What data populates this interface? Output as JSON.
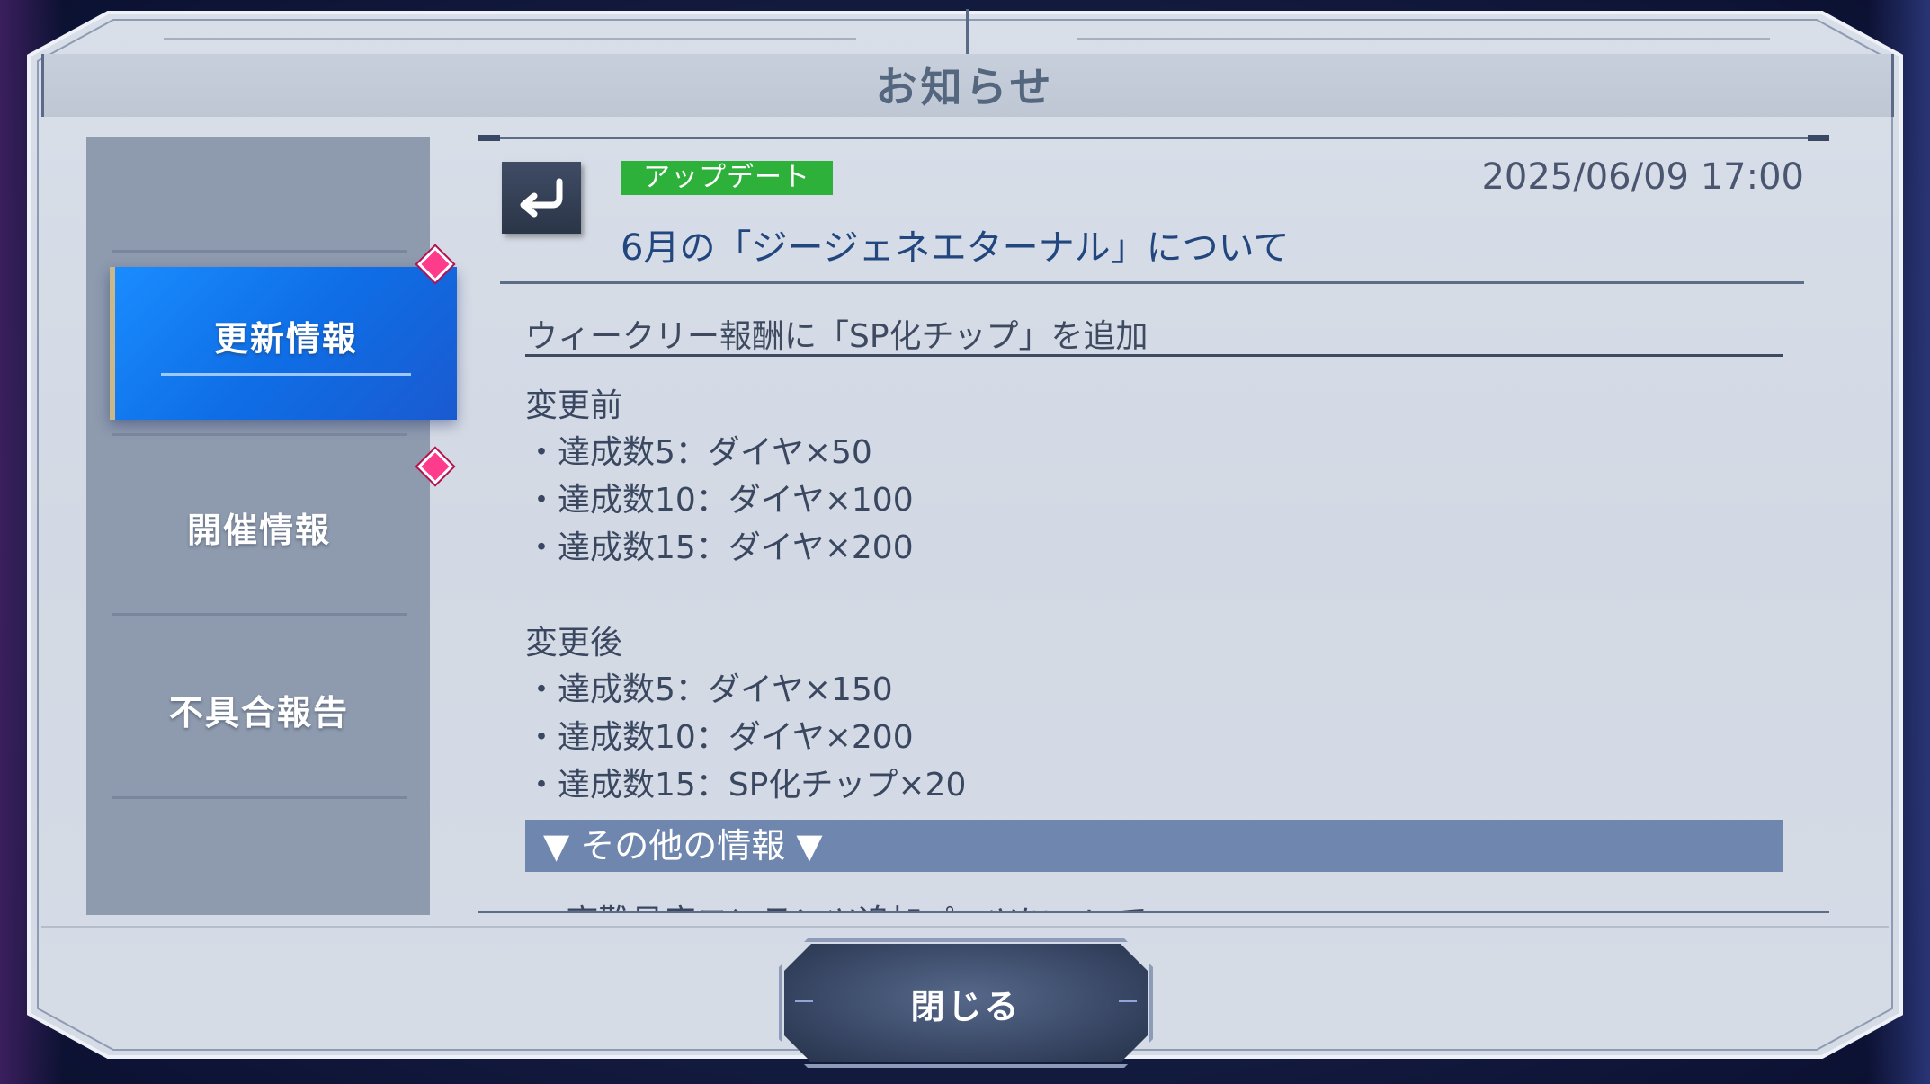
{
  "window": {
    "title": "お知らせ"
  },
  "sidebar": {
    "items": [
      {
        "label": "更新情報",
        "active": true,
        "has_notice": true
      },
      {
        "label": "開催情報",
        "active": false,
        "has_notice": true
      },
      {
        "label": "不具合報告",
        "active": false,
        "has_notice": false
      }
    ]
  },
  "article": {
    "back_icon": "return-arrow-icon",
    "tag": "アップデート",
    "tag_color": "#2db13a",
    "date": "2025/06/09 17:00",
    "headline": "6月の「ジージェネエターナル」について",
    "subhead": "ウィークリー報酬に「SP化チップ」を追加",
    "before_label": "変更前",
    "before_items": [
      "・達成数5：ダイヤ×50",
      "・達成数10：ダイヤ×100",
      "・達成数15：ダイヤ×200"
    ],
    "after_label": "変更後",
    "after_items": [
      "・達成数5：ダイヤ×150",
      "・達成数10：ダイヤ×200",
      "・達成数15：SP化チップ×20"
    ],
    "other_info": "▼ その他の情報 ▼",
    "next_item_partial": "■ 高難易度コンテンツ追加パーツについて"
  },
  "footer": {
    "close_label": "閉じる"
  },
  "colors": {
    "accent_blue": "#1a8cff",
    "notice_pink": "#ff3c8c",
    "headline_blue": "#22467e"
  }
}
